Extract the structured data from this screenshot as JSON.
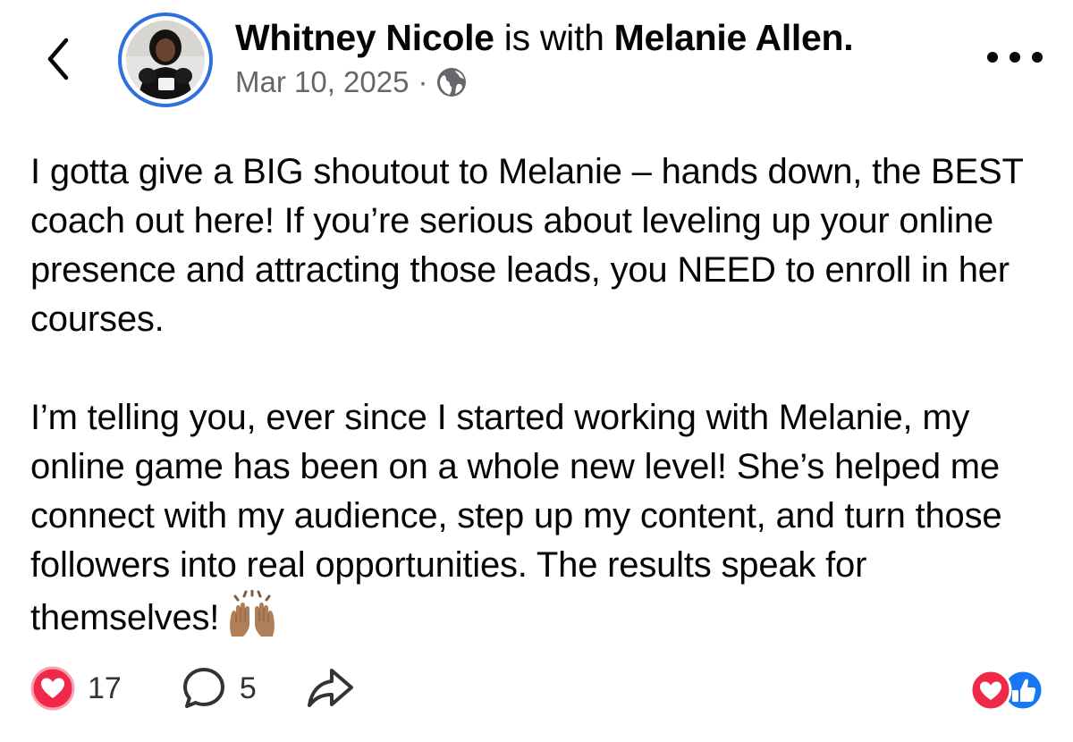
{
  "header": {
    "author": "Whitney Nicole",
    "with_text": "is with",
    "tagged": "Melanie Allen.",
    "date": "Mar 10, 2025",
    "separator": "·",
    "audience_icon": "globe-icon"
  },
  "post": {
    "paragraphs": [
      "I gotta give a BIG shoutout to Melanie – hands down, the BEST coach out here! If you’re serious about leveling up your online presence and attracting those leads, you NEED to enroll in her courses.",
      "I’m telling you, ever since I started working with Melanie, my online game has been on a whole new level! She’s helped me connect with my audience, step up my content, and turn those followers into real opportunities. The results speak for themselves!"
    ],
    "emoji": "raising-hands-emoji"
  },
  "footer": {
    "likes": "17",
    "comments": "5",
    "reactions": [
      "love-reaction-icon",
      "like-reaction-icon"
    ]
  },
  "colors": {
    "avatar_ring": "#2f6fe0",
    "love": "#f0284a",
    "like": "#1877f2",
    "meta_text": "#65676b"
  }
}
